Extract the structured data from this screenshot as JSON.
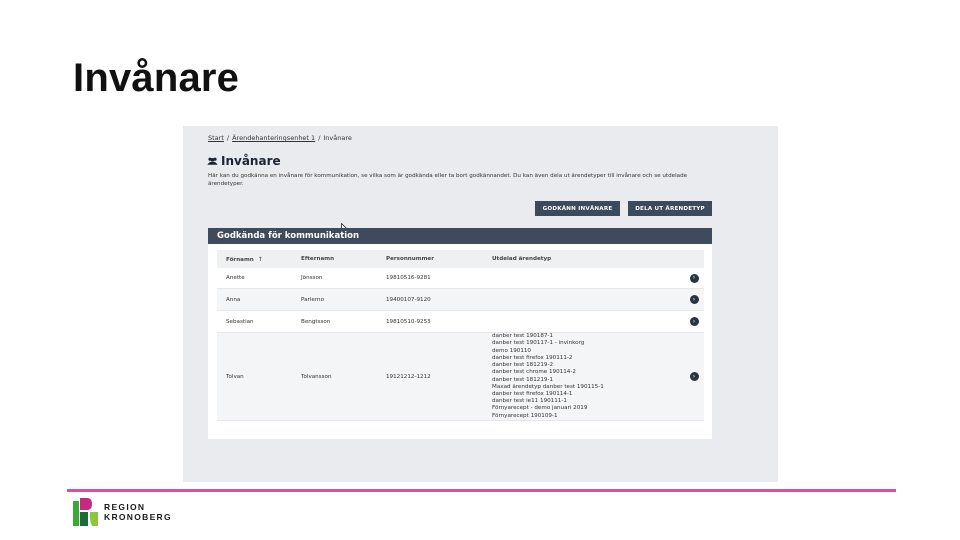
{
  "slide": {
    "title": "Invånare"
  },
  "app": {
    "breadcrumb": [
      "Start",
      "Ärendehanteringsenhet 1",
      "Invånare"
    ],
    "breadcrumb_separator": "/",
    "heading": "Invånare",
    "heading_icon": "users-icon",
    "description": "Här kan du godkänna en invånare för kommunikation, se vilka som är godkända eller ta bort godkännandet. Du kan även dela ut ärendetyper till invånare och se utdelade ärendetyper.",
    "buttons": {
      "approve": "Godkänn invånare",
      "share_type": "Dela ut ärendetyp"
    },
    "panel_title": "Godkända för kommunikation",
    "table": {
      "headers": [
        "Förnamn",
        "Efternamn",
        "Personnummer",
        "Utdelad ärendetyp"
      ],
      "sort_icon": "↑",
      "rows": [
        {
          "first": "Anette",
          "last": "Jönsson",
          "pnr": "19810516-9281",
          "types": []
        },
        {
          "first": "Anna",
          "last": "Parlerno",
          "pnr": "19400107-9120",
          "types": []
        },
        {
          "first": "Sebastian",
          "last": "Bengtsson",
          "pnr": "19810510-9253",
          "types": []
        },
        {
          "first": "Tolvan",
          "last": "Tolvansson",
          "pnr": "19121212-1212",
          "types": [
            "danber test 190187-1",
            "danber test 190117-1 - invinkorg",
            "demo 190110",
            "danber test firefox 190111-2",
            "danber test 181219-2",
            "danber test chrome 190114-2",
            "danber test 181219-1",
            "Maxad ärendetyp danber test 190115-1",
            "danber test firefox 190114-1",
            "danber test ie11 190111-1",
            "Förnyarecept - demo januari 2019",
            "Förnyarecept 190109-1"
          ]
        }
      ],
      "row_action_icon": "chevron-right-icon"
    }
  },
  "logo": {
    "line1": "REGION",
    "line2": "KRONOBERG",
    "colors": {
      "green": "#3aa935",
      "magenta": "#c8287e",
      "dark_green": "#1e6b3a",
      "light_green": "#8cc63f"
    }
  },
  "colors": {
    "divider": "#d94fa3",
    "panel_header": "#3e4b5c",
    "button": "#3b4a5c"
  }
}
